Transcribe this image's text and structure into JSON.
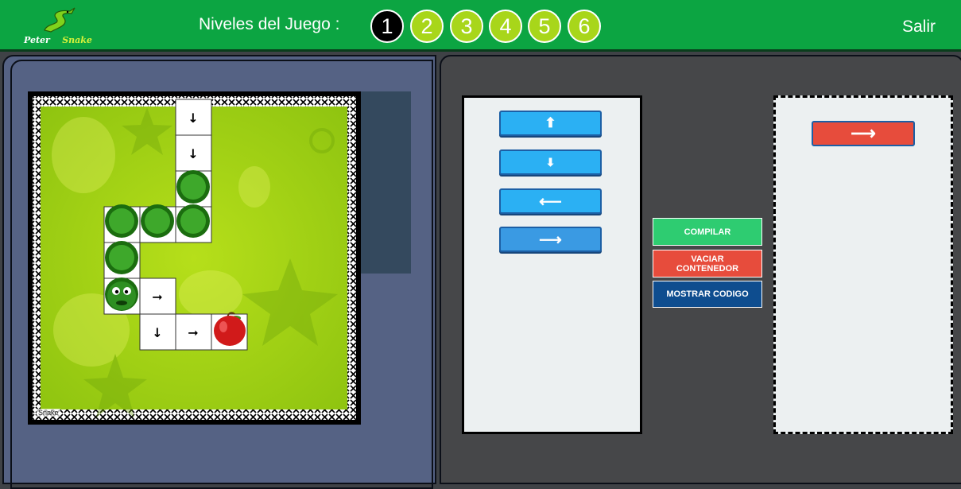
{
  "header": {
    "logo_word1": "Peter",
    "logo_word2": "Snake",
    "levels_label": "Niveles del Juego :",
    "levels": [
      "1",
      "2",
      "3",
      "4",
      "5",
      "6"
    ],
    "active_level": "1",
    "exit_label": "Salir"
  },
  "board": {
    "tag": "Snake"
  },
  "palette": {
    "commands": [
      {
        "icon": "arrow-up-icon",
        "glyph": "⬆"
      },
      {
        "icon": "arrow-down-icon",
        "glyph": "⬇"
      },
      {
        "icon": "arrow-left-icon",
        "glyph": "⟵"
      },
      {
        "icon": "arrow-right-icon",
        "glyph": "⟶"
      }
    ]
  },
  "actions": {
    "compile": "COMPILAR",
    "empty": "VACIAR CONTENEDOR",
    "show_code": "MOSTRAR CODIGO"
  },
  "container": {
    "placed_command": {
      "icon": "arrow-right-icon",
      "glyph": "⟶"
    }
  },
  "colors": {
    "header": "#0ca542",
    "level_button": "#a8d61a",
    "command_button": "#2bb0f3",
    "compile": "#2ecc71",
    "empty": "#e74c3c",
    "show_code": "#0e4d8f"
  }
}
